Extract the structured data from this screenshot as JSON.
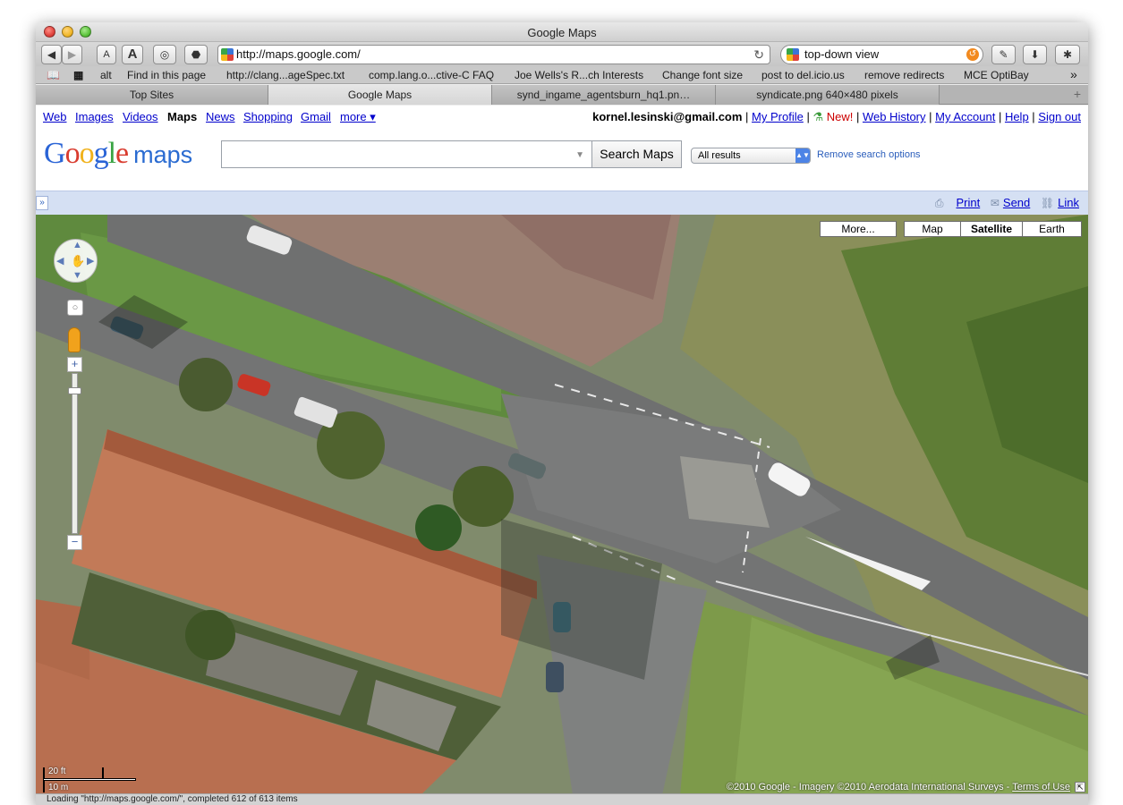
{
  "window": {
    "title": "Google Maps"
  },
  "toolbar": {
    "back_icon": "back-arrow-icon",
    "forward_icon": "forward-arrow-icon",
    "font_small": "A",
    "font_large": "A",
    "url": "http://maps.google.com/",
    "search_query": "top-down view"
  },
  "bookmarks": [
    "alt",
    "Find in this page",
    "http://clang...ageSpec.txt",
    "comp.lang.o...ctive-C FAQ",
    "Joe Wells's R...ch Interests",
    "Change font size",
    "post to del.icio.us",
    "remove redirects",
    "MCE OptiBay"
  ],
  "bookmarks_more": "»",
  "tabs": [
    {
      "label": "Top Sites",
      "active": false
    },
    {
      "label": "Google Maps",
      "active": true
    },
    {
      "label": "synd_ingame_agentsburn_hq1.pn…",
      "active": false
    },
    {
      "label": "syndicate.png 640×480 pixels",
      "active": false
    }
  ],
  "tabs_add": "+",
  "gbar": {
    "links": [
      "Web",
      "Images",
      "Videos",
      "Maps",
      "News",
      "Shopping",
      "Gmail",
      "more ▾"
    ],
    "active": "Maps",
    "email": "kornel.lesinski@gmail.com",
    "profile": "My Profile",
    "new_label": "New!",
    "web_history": "Web History",
    "my_account": "My Account",
    "help": "Help",
    "sign_out": "Sign out"
  },
  "search": {
    "logo_google": "Google",
    "logo_maps": "maps",
    "query": "",
    "button": "Search Maps",
    "results_filter": "All results",
    "remove_options": "Remove search options"
  },
  "strip": {
    "collapse": "»",
    "print": "Print",
    "send": "Send",
    "link": "Link"
  },
  "map": {
    "buttons": [
      "More...",
      "Map",
      "Satellite",
      "Earth"
    ],
    "selected": "Satellite",
    "scale_ft": "20 ft",
    "scale_m": "10 m",
    "copyright": "©2010 Google - Imagery ©2010 Aerodata International Surveys -",
    "terms": "Terms of Use"
  },
  "status": "Loading \"http://maps.google.com/\", completed 612 of 613 items"
}
